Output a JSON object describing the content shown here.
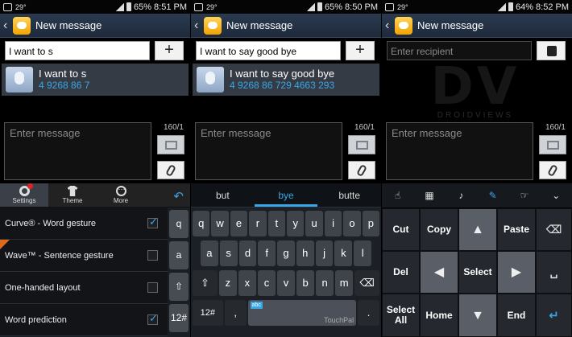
{
  "screens": [
    {
      "status": {
        "temp": "29°",
        "battery": "65%",
        "time": "8:51 PM"
      },
      "title": "New message",
      "recipient_value": "I want to s",
      "suggestion": {
        "name": "I want to s",
        "number": "4 9268 86 7"
      },
      "message_placeholder": "Enter message",
      "counter": "160/1"
    },
    {
      "status": {
        "temp": "29°",
        "battery": "65%",
        "time": "8:50 PM"
      },
      "title": "New message",
      "recipient_value": "I want to say good bye",
      "suggestion": {
        "name": "I want to say good bye",
        "number": "4 9268 86 729 4663 293"
      },
      "message_placeholder": "Enter message",
      "counter": "160/1"
    },
    {
      "status": {
        "temp": "29°",
        "battery": "64%",
        "time": "8:52 PM"
      },
      "title": "New message",
      "recipient_placeholder": "Enter recipient",
      "message_placeholder": "Enter message",
      "counter": "160/1"
    }
  ],
  "settings_panel": {
    "tabs": [
      "Settings",
      "Theme",
      "More"
    ],
    "items": [
      {
        "label": "Curve® - Word gesture",
        "checked": true
      },
      {
        "label": "Wave™ - Sentence gesture",
        "checked": false,
        "tag": "new"
      },
      {
        "label": "One-handed layout",
        "checked": false
      },
      {
        "label": "Word prediction",
        "checked": true
      }
    ],
    "side_keys": [
      "q",
      "a",
      "⇧",
      "12#"
    ]
  },
  "keyboard": {
    "candidates": [
      "but",
      "bye",
      "butte"
    ],
    "rows": [
      [
        "q",
        "w",
        "e",
        "r",
        "t",
        "y",
        "u",
        "i",
        "o",
        "p"
      ],
      [
        "a",
        "s",
        "d",
        "f",
        "g",
        "h",
        "j",
        "k",
        "l"
      ],
      [
        "⇧",
        "z",
        "x",
        "c",
        "v",
        "b",
        "n",
        "m",
        "⌫"
      ]
    ],
    "bottom": {
      "mode": "12#",
      "comma": ",",
      "space_tag": "abc",
      "space_brand": "TouchPal",
      "period": "."
    }
  },
  "edit_panel": {
    "keys": [
      "Cut",
      "Copy",
      "Paste",
      "Del",
      "Select",
      "Select All",
      "Home",
      "End"
    ]
  },
  "watermark": {
    "mark": "DV",
    "text": "DROIDVIEWS"
  },
  "colors": {
    "accent": "#39a6e6",
    "suggestion_bg": "#353b45",
    "titlebar": "#2b3a4f"
  }
}
